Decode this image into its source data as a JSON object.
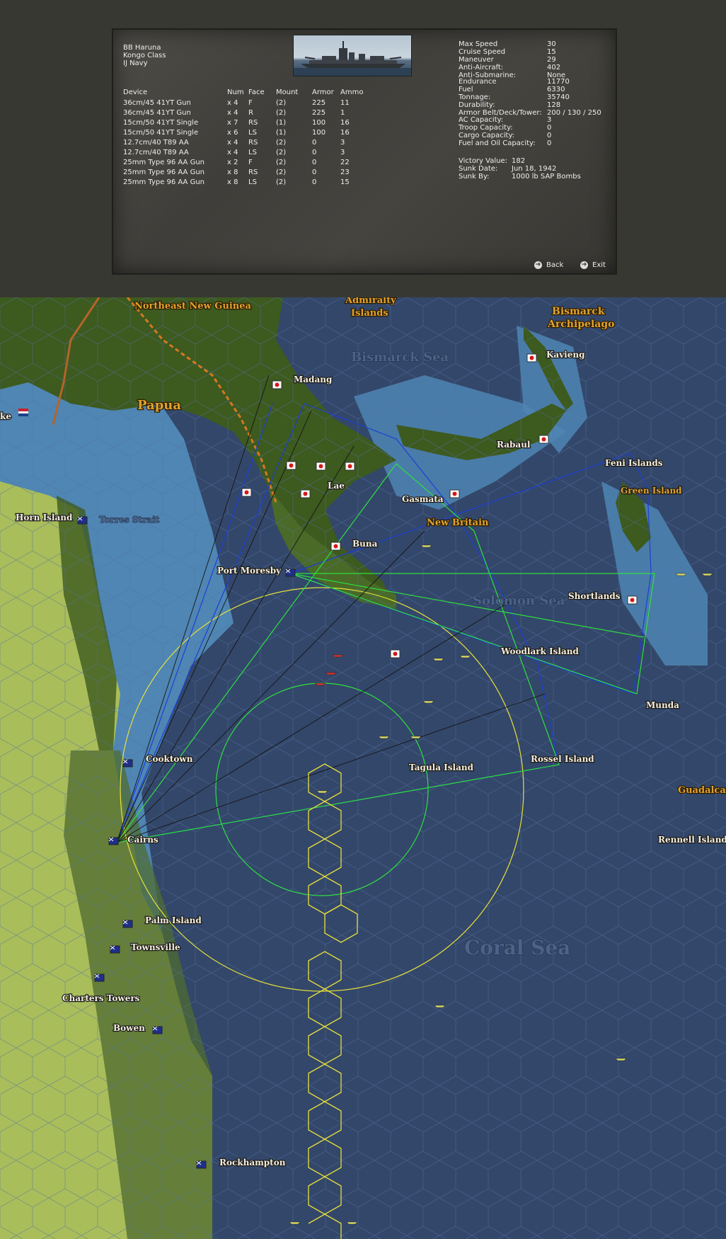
{
  "ship": {
    "name": "BB Haruna",
    "class": "Kongo Class",
    "navy": "IJ Navy",
    "photo_icon": "battleship-photo"
  },
  "devices": {
    "headers": [
      "Device",
      "Num",
      "Face",
      "Mount",
      "Armor",
      "Ammo"
    ],
    "rows": [
      [
        "36cm/45 41YT Gun",
        "x 4",
        "F",
        "(2)",
        "225",
        "11"
      ],
      [
        "36cm/45 41YT Gun",
        "x 4",
        "R",
        "(2)",
        "225",
        "1"
      ],
      [
        "15cm/50 41YT Single",
        "x 7",
        "RS",
        "(1)",
        "100",
        "16"
      ],
      [
        "15cm/50 41YT Single",
        "x 6",
        "LS",
        "(1)",
        "100",
        "16"
      ],
      [
        "12.7cm/40 T89 AA",
        "x 4",
        "RS",
        "(2)",
        "0",
        "3"
      ],
      [
        "12.7cm/40 T89 AA",
        "x 4",
        "LS",
        "(2)",
        "0",
        "3"
      ],
      [
        "25mm Type 96 AA Gun",
        "x 2",
        "F",
        "(2)",
        "0",
        "22"
      ],
      [
        "25mm Type 96 AA Gun",
        "x 8",
        "RS",
        "(2)",
        "0",
        "23"
      ],
      [
        "25mm Type 96 AA Gun",
        "x 8",
        "LS",
        "(2)",
        "0",
        "15"
      ]
    ]
  },
  "stats": {
    "group1": [
      {
        "label": "Max Speed",
        "value": "30"
      },
      {
        "label": "Cruise Speed",
        "value": "15"
      },
      {
        "label": "Maneuver",
        "value": "29"
      },
      {
        "label": "Anti-Aircraft:",
        "value": "402"
      },
      {
        "label": "Anti-Submarine:",
        "value": "None"
      }
    ],
    "group2": [
      {
        "label": "Endurance",
        "value": "11770"
      },
      {
        "label": "Fuel",
        "value": "6330"
      },
      {
        "label": "Tonnage:",
        "value": "35740"
      },
      {
        "label": "Durability:",
        "value": "128"
      },
      {
        "label": "Armor Belt/Deck/Tower:",
        "value": "200 / 130 / 250"
      }
    ],
    "group3": [
      {
        "label": "AC Capacity:",
        "value": "3"
      },
      {
        "label": "Troop Capacity:",
        "value": "0"
      },
      {
        "label": "Cargo Capacity:",
        "value": "0"
      },
      {
        "label": "Fuel and Oil Capacity:",
        "value": "0"
      }
    ],
    "group4": [
      {
        "label": "Victory Value:",
        "value": "182"
      },
      {
        "label": "Sunk Date:",
        "value": "Jun 18, 1942"
      },
      {
        "label": "Sunk By:",
        "value": "1000 lb SAP Bombs"
      }
    ]
  },
  "buttons": {
    "back": "Back",
    "exit": "Exit",
    "icon": "arrow-right-icon"
  },
  "map": {
    "regions": [
      "Northeast New Guinea",
      "Admiralty",
      "Islands",
      "Bismarck",
      "Archipelago",
      "Papua",
      "New Britain",
      "Guadalcanal"
    ],
    "seas": [
      "Bismarck Sea",
      "Solomon Sea",
      "Coral Sea"
    ],
    "places": [
      "Madang",
      "Kavieng",
      "Rabaul",
      "Feni Islands",
      "Green Island",
      "Lae",
      "Gasmata",
      "Horn Island",
      "Torres Strait",
      "Buna",
      "Port Moresby",
      "Shortlands",
      "Woodlark Island",
      "Munda",
      "Cooktown",
      "Tagula Island",
      "Rossel Island",
      "Cairns",
      "Rennell Island",
      "Palm Island",
      "Townsville",
      "Charters Towers",
      "Bowen",
      "Rockhampton",
      "ke"
    ],
    "colors": {
      "ocean_deep": "#33476a",
      "ocean_shallow": "#4f86b4",
      "jungle": "#3d5a1f",
      "grassland": "#a9bd5a",
      "allied_range": "#1c3fd6",
      "japan_range": "#2ee03d",
      "search_arc": "#e8e03a"
    },
    "icons": [
      "japan-base-flag-icon",
      "allied-base-flag-icon",
      "dutch-flag-icon",
      "naval-unit-icon"
    ]
  }
}
